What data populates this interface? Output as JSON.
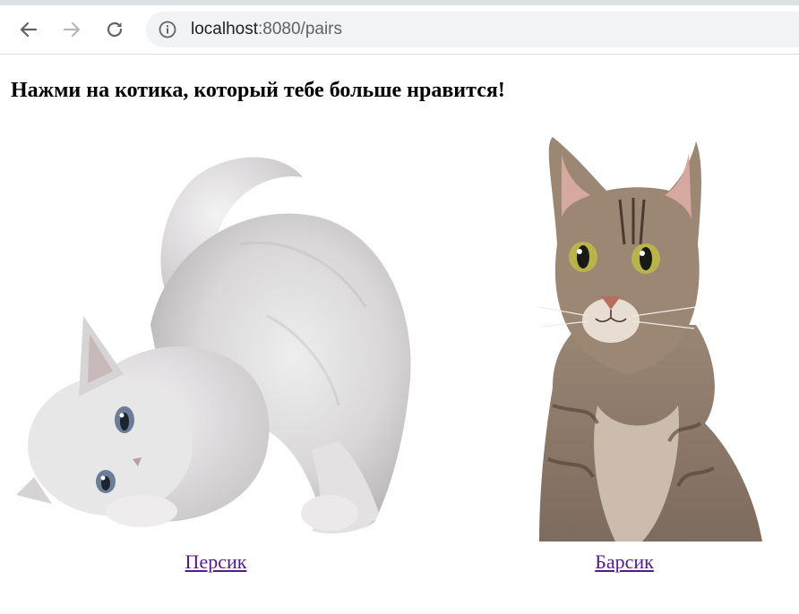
{
  "browser": {
    "url_host": "localhost",
    "url_path": ":8080/pairs",
    "icons": {
      "back": "arrow-left-icon",
      "forward": "arrow-right-icon",
      "reload": "reload-icon",
      "info": "info-icon"
    }
  },
  "page": {
    "heading": "Нажми на котика, который тебе больше нравится!",
    "cats": [
      {
        "name": "Персик"
      },
      {
        "name": "Барсик"
      }
    ]
  },
  "colors": {
    "link_visited": "#551a8b",
    "toolbar_icon": "#5f6368",
    "omnibox_bg": "#f1f3f4"
  }
}
